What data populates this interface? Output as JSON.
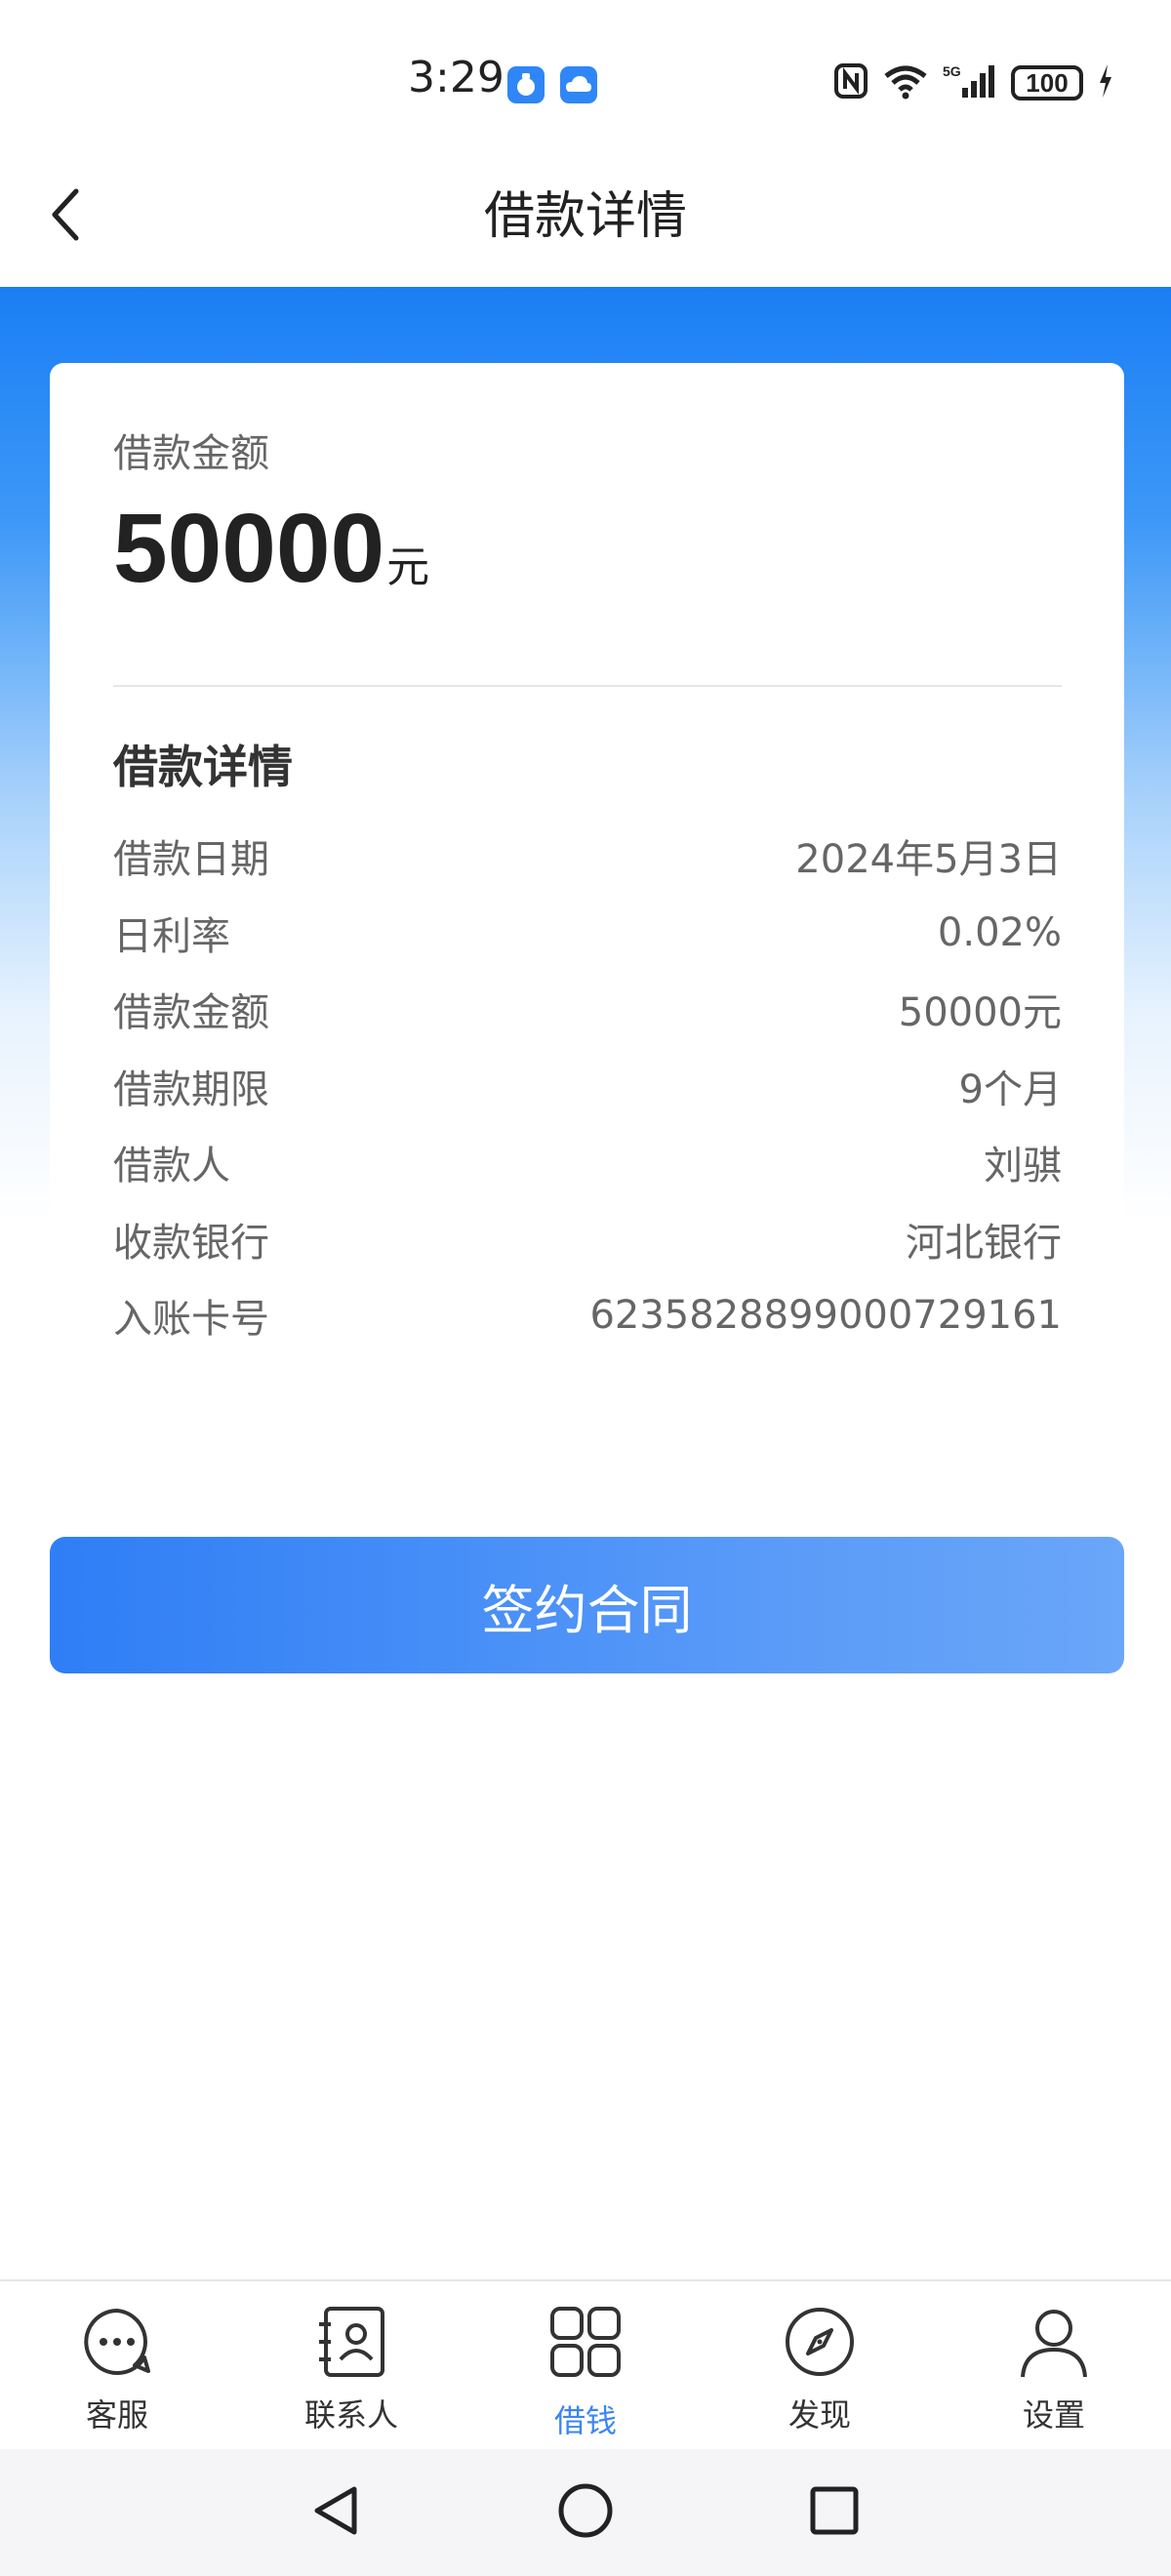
{
  "status_bar": {
    "time": "3:29",
    "battery": "100"
  },
  "header": {
    "title": "借款详情"
  },
  "loan": {
    "amount_label": "借款金额",
    "amount_value": "50000",
    "amount_unit": "元"
  },
  "details": {
    "title": "借款详情",
    "rows": [
      {
        "label": "借款日期",
        "value": "2024年5月3日"
      },
      {
        "label": "日利率",
        "value": "0.02%"
      },
      {
        "label": "借款金额",
        "value": "50000元"
      },
      {
        "label": "借款期限",
        "value": "9个月"
      },
      {
        "label": "借款人",
        "value": "刘骐"
      },
      {
        "label": "收款银行",
        "value": "河北银行"
      },
      {
        "label": "入账卡号",
        "value": "6235828899000729161"
      }
    ]
  },
  "actions": {
    "sign_label": "签约合同"
  },
  "bottom_nav": {
    "items": [
      {
        "label": "客服",
        "icon": "chat-bubble-icon"
      },
      {
        "label": "联系人",
        "icon": "contact-book-icon"
      },
      {
        "label": "借钱",
        "icon": "grid-icon"
      },
      {
        "label": "发现",
        "icon": "compass-icon"
      },
      {
        "label": "设置",
        "icon": "person-icon"
      }
    ],
    "active_index": 2
  },
  "colors": {
    "accent": "#3a86f5",
    "hero_top": "#1a7ef5",
    "button_start": "#2f7ef6",
    "button_end": "#6aa6f9"
  }
}
